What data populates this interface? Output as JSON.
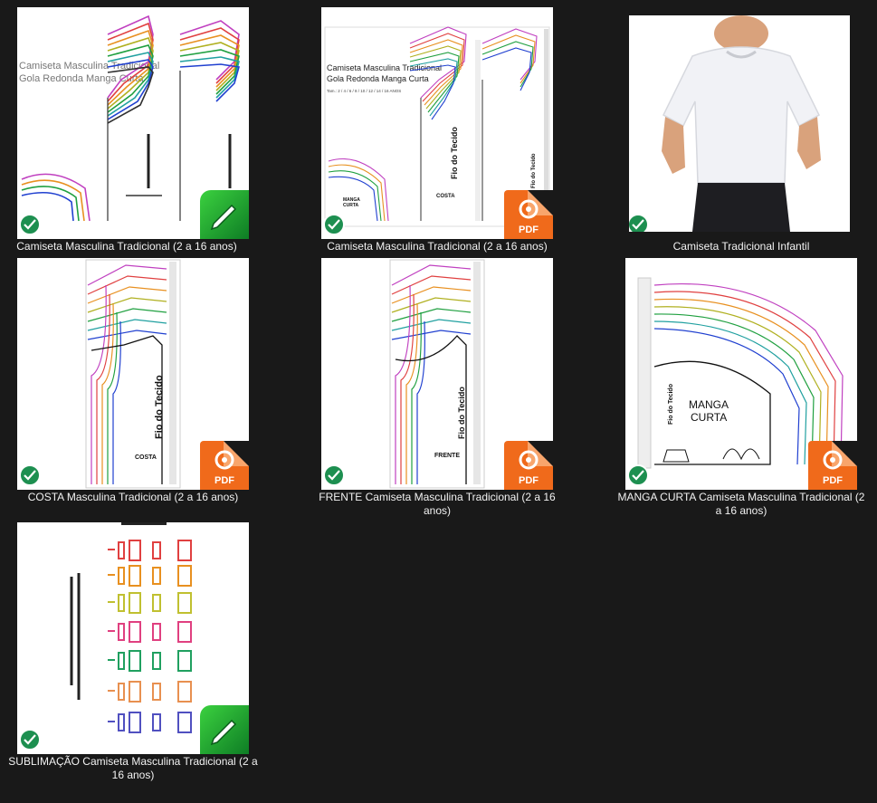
{
  "files": [
    {
      "name": "Camiseta Masculina Tradicional (2 a 16 anos)",
      "type": "edit",
      "synced": true
    },
    {
      "name": "Camiseta Masculina Tradicional (2 a 16 anos)",
      "type": "pdf",
      "synced": true
    },
    {
      "name": "Camiseta Tradicional Infantil",
      "type": "image",
      "synced": true
    },
    {
      "name": "COSTA Masculina Tradicional (2 a 16 anos)",
      "type": "pdf",
      "synced": true
    },
    {
      "name": "FRENTE Camiseta Masculina Tradicional (2 a 16 anos)",
      "type": "pdf",
      "synced": true
    },
    {
      "name": "MANGA CURTA Camiseta Masculina Tradicional (2 a 16 anos)",
      "type": "pdf",
      "synced": true
    },
    {
      "name": "SUBLIMAÇÃO Camiseta Masculina Tradicional (2 a 16 anos)",
      "type": "edit",
      "synced": true
    }
  ],
  "thumb_text": {
    "title_line1": "Camiseta Masculina Tradicional",
    "title_line2": "Gola Redonda Manga Curta",
    "sizes": "Tam.: 2 / 4 / 6 / 8 / 10 / 12 / 14 / 16 ANOS",
    "grain": "Fio do Tecido",
    "costa": "COSTA",
    "frente": "FRENTE",
    "manga1": "MANGA",
    "manga2": "CURTA",
    "pdf_label": "PDF"
  }
}
